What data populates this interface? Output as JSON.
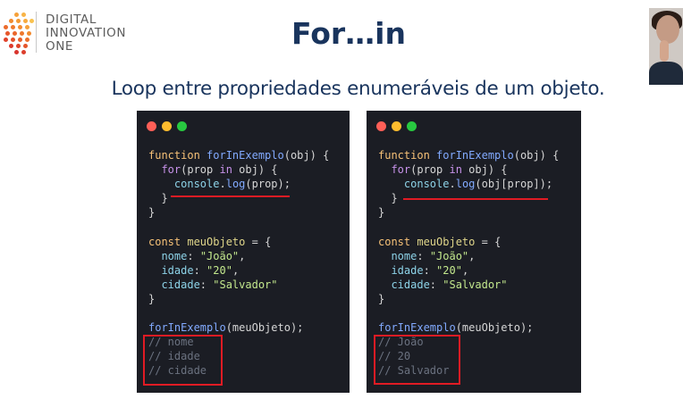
{
  "brand": {
    "logo_line1": "DIGITAL",
    "logo_line2": "INNOVATION",
    "logo_line3": "ONE"
  },
  "slide": {
    "title": "For…in",
    "subtitle": "Loop entre propriedades enumeráveis de um objeto."
  },
  "colors": {
    "title": "#19345d",
    "editor_bg": "#1b1d24",
    "highlight_red": "#e01b24",
    "keyword": "#c792ea",
    "string": "#c3e88d",
    "function": "#82aaff",
    "comment": "#6b7280"
  },
  "webcam": {
    "icon": "presenter-video-feed"
  },
  "examples": [
    {
      "lines": [
        {
          "tokens": [
            {
              "t": "function ",
              "c": "kw2"
            },
            {
              "t": "forInExemplo",
              "c": "fn"
            },
            {
              "t": "(obj) {",
              "c": "plain"
            }
          ]
        },
        {
          "tokens": [
            {
              "t": "  for",
              "c": "kw"
            },
            {
              "t": "(prop ",
              "c": "plain"
            },
            {
              "t": "in",
              "c": "kw"
            },
            {
              "t": " obj) {",
              "c": "plain"
            }
          ]
        },
        {
          "tokens": [
            {
              "t": "    console",
              "c": "prop"
            },
            {
              "t": ".",
              "c": "plain"
            },
            {
              "t": "log",
              "c": "method"
            },
            {
              "t": "(prop);",
              "c": "plain"
            }
          ]
        },
        {
          "tokens": [
            {
              "t": "  }",
              "c": "plain"
            }
          ]
        },
        {
          "tokens": [
            {
              "t": "}",
              "c": "plain"
            }
          ]
        },
        {
          "tokens": [
            {
              "t": "",
              "c": "plain"
            }
          ]
        },
        {
          "tokens": [
            {
              "t": "const ",
              "c": "kw2"
            },
            {
              "t": "meuObjeto",
              "c": "id"
            },
            {
              "t": " = {",
              "c": "plain"
            }
          ]
        },
        {
          "tokens": [
            {
              "t": "  nome",
              "c": "prop"
            },
            {
              "t": ": ",
              "c": "plain"
            },
            {
              "t": "\"João\"",
              "c": "str"
            },
            {
              "t": ",",
              "c": "plain"
            }
          ]
        },
        {
          "tokens": [
            {
              "t": "  idade",
              "c": "prop"
            },
            {
              "t": ": ",
              "c": "plain"
            },
            {
              "t": "\"20\"",
              "c": "str"
            },
            {
              "t": ",",
              "c": "plain"
            }
          ]
        },
        {
          "tokens": [
            {
              "t": "  cidade",
              "c": "prop"
            },
            {
              "t": ": ",
              "c": "plain"
            },
            {
              "t": "\"Salvador\"",
              "c": "str"
            }
          ]
        },
        {
          "tokens": [
            {
              "t": "}",
              "c": "plain"
            }
          ]
        },
        {
          "tokens": [
            {
              "t": "",
              "c": "plain"
            }
          ]
        },
        {
          "tokens": [
            {
              "t": "forInExemplo",
              "c": "fn"
            },
            {
              "t": "(meuObjeto);",
              "c": "plain"
            }
          ]
        },
        {
          "tokens": [
            {
              "t": "// nome",
              "c": "cm"
            }
          ]
        },
        {
          "tokens": [
            {
              "t": "// idade",
              "c": "cm"
            }
          ]
        },
        {
          "tokens": [
            {
              "t": "// cidade",
              "c": "cm"
            }
          ]
        }
      ]
    },
    {
      "lines": [
        {
          "tokens": [
            {
              "t": "function ",
              "c": "kw2"
            },
            {
              "t": "forInExemplo",
              "c": "fn"
            },
            {
              "t": "(obj) {",
              "c": "plain"
            }
          ]
        },
        {
          "tokens": [
            {
              "t": "  for",
              "c": "kw"
            },
            {
              "t": "(prop ",
              "c": "plain"
            },
            {
              "t": "in",
              "c": "kw"
            },
            {
              "t": " obj) {",
              "c": "plain"
            }
          ]
        },
        {
          "tokens": [
            {
              "t": "    console",
              "c": "prop"
            },
            {
              "t": ".",
              "c": "plain"
            },
            {
              "t": "log",
              "c": "method"
            },
            {
              "t": "(obj[prop]);",
              "c": "plain"
            }
          ]
        },
        {
          "tokens": [
            {
              "t": "  }",
              "c": "plain"
            }
          ]
        },
        {
          "tokens": [
            {
              "t": "}",
              "c": "plain"
            }
          ]
        },
        {
          "tokens": [
            {
              "t": "",
              "c": "plain"
            }
          ]
        },
        {
          "tokens": [
            {
              "t": "const ",
              "c": "kw2"
            },
            {
              "t": "meuObjeto",
              "c": "id"
            },
            {
              "t": " = {",
              "c": "plain"
            }
          ]
        },
        {
          "tokens": [
            {
              "t": "  nome",
              "c": "prop"
            },
            {
              "t": ": ",
              "c": "plain"
            },
            {
              "t": "\"João\"",
              "c": "str"
            },
            {
              "t": ",",
              "c": "plain"
            }
          ]
        },
        {
          "tokens": [
            {
              "t": "  idade",
              "c": "prop"
            },
            {
              "t": ": ",
              "c": "plain"
            },
            {
              "t": "\"20\"",
              "c": "str"
            },
            {
              "t": ",",
              "c": "plain"
            }
          ]
        },
        {
          "tokens": [
            {
              "t": "  cidade",
              "c": "prop"
            },
            {
              "t": ": ",
              "c": "plain"
            },
            {
              "t": "\"Salvador\"",
              "c": "str"
            }
          ]
        },
        {
          "tokens": [
            {
              "t": "}",
              "c": "plain"
            }
          ]
        },
        {
          "tokens": [
            {
              "t": "",
              "c": "plain"
            }
          ]
        },
        {
          "tokens": [
            {
              "t": "forInExemplo",
              "c": "fn"
            },
            {
              "t": "(meuObjeto);",
              "c": "plain"
            }
          ]
        },
        {
          "tokens": [
            {
              "t": "// João",
              "c": "cm"
            }
          ]
        },
        {
          "tokens": [
            {
              "t": "// 20",
              "c": "cm"
            }
          ]
        },
        {
          "tokens": [
            {
              "t": "// Salvador",
              "c": "cm"
            }
          ]
        }
      ]
    }
  ]
}
